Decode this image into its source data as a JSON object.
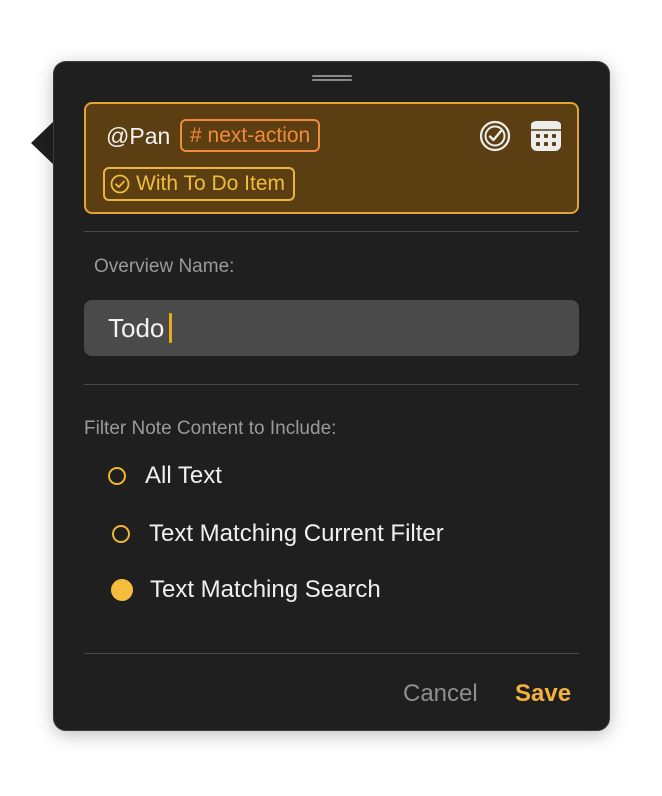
{
  "filter": {
    "mention": "@Pan",
    "tag": "# next-action",
    "todo_chip": "With To Do Item",
    "icons": [
      "checkmark-circle-icon",
      "calendar-icon"
    ]
  },
  "overview_name": {
    "label": "Overview Name:",
    "value": "Todo"
  },
  "content_filter": {
    "label": "Filter Note Content to Include:",
    "options": [
      {
        "label": "All Text",
        "selected": false
      },
      {
        "label": "Text Matching Current Filter",
        "selected": false
      },
      {
        "label": "Text Matching Search",
        "selected": true
      }
    ]
  },
  "actions": {
    "cancel": "Cancel",
    "save": "Save"
  },
  "colors": {
    "accent": "#f4b23a",
    "tag": "#f5893a",
    "panel": "#1f1f1f",
    "filter_box": "#5b3f12"
  }
}
